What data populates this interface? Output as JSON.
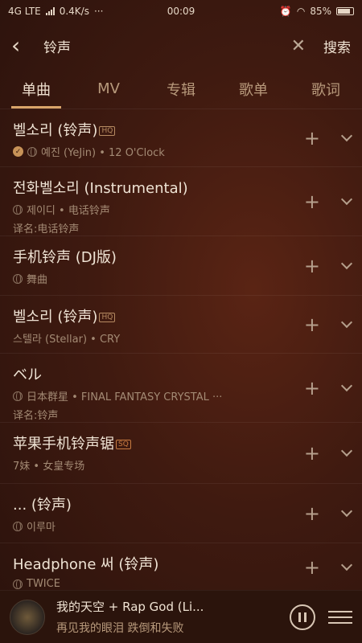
{
  "status": {
    "network": "4G LTE",
    "speed": "0.4K/s",
    "dots": "···",
    "time": "00:09",
    "battery": "85%"
  },
  "search": {
    "back_icon": "chevron-left-icon",
    "query": "铃声",
    "search_label": "搜索"
  },
  "tabs": [
    {
      "label": "单曲"
    },
    {
      "label": "MV"
    },
    {
      "label": "专辑"
    },
    {
      "label": "歌单"
    },
    {
      "label": "歌词"
    }
  ],
  "results": [
    {
      "title": "벨소리 (铃声)",
      "badge": "HQ",
      "sub": "예진 (YeJin) • 12 O'Clock",
      "alias": ""
    },
    {
      "title": "전화벨소리 (Instrumental)",
      "badge": "",
      "sub": "제이디 • 电话铃声",
      "alias": "译名:电话铃声"
    },
    {
      "title": "手机铃声 (DJ版)",
      "badge": "",
      "sub": "舞曲",
      "alias": ""
    },
    {
      "title": "벨소리 (铃声)",
      "badge": "HQ",
      "sub": "스텔라 (Stellar) • CRY",
      "alias": ""
    },
    {
      "title": "ベル",
      "badge": "",
      "sub": "日本群星 • FINAL FANTASY CRYSTAL ···",
      "alias": "译名:铃声"
    },
    {
      "title": "苹果手机铃声锯",
      "badge": "SQ",
      "sub": "7妹 • 女皇专场",
      "alias": ""
    },
    {
      "title": "... (铃声)",
      "badge": "",
      "sub": "이루마",
      "alias": ""
    },
    {
      "title": "Headphone 써 (铃声)",
      "badge": "",
      "sub": "TWICE",
      "alias": ""
    }
  ],
  "player": {
    "title": "我的天空 + Rap God (Li...",
    "lyric": "再见我的眼泪 跌倒和失败"
  },
  "colors": {
    "accent": "#d9a56a",
    "background": "#3f1a10"
  }
}
